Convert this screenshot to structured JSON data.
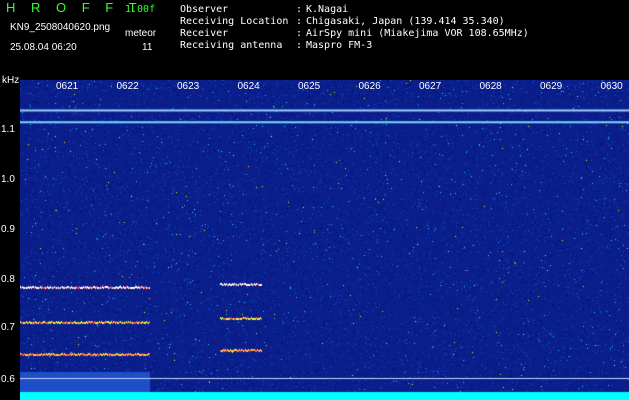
{
  "header": {
    "app_name": "H R O F F T",
    "version": "1.00f",
    "filename": "KN9_2508040620.png",
    "mode": "meteor",
    "datetime": "25.08.04 06:20",
    "count": "11",
    "meta": [
      {
        "key": "Observer",
        "value": "K.Nagai"
      },
      {
        "key": "Receiving Location",
        "value": "Chigasaki, Japan (139.414 35.340)"
      },
      {
        "key": "Receiver",
        "value": "AirSpy mini (Miakejima VOR 108.65MHz)"
      },
      {
        "key": "Receiving antenna",
        "value": "Maspro FM-3"
      }
    ]
  },
  "axis": {
    "ylabel": "kHz",
    "y_ticks": [
      "1.1",
      "1.0",
      "0.9",
      "0.8",
      "0.7",
      "0.6"
    ],
    "x_ticks": [
      "0621",
      "0622",
      "0623",
      "0624",
      "0625",
      "0626",
      "0627",
      "0628",
      "0629",
      "0630"
    ]
  },
  "colors": {
    "background": "#000000",
    "noise_base": "#0a1e8c",
    "trace": "#ffffff",
    "text": "#ffffff",
    "accent": "#33ff33",
    "baseline": "#00ffff"
  },
  "chart_data": {
    "type": "heatmap",
    "xlabel": "",
    "ylabel": "kHz",
    "ylim": [
      0.58,
      1.14
    ],
    "x": [
      "0621",
      "0622",
      "0623",
      "0624",
      "0625",
      "0626",
      "0627",
      "0628",
      "0629",
      "0630"
    ],
    "series": [
      {
        "values": [
          1.09
        ]
      },
      {
        "values": [
          1.07
        ]
      }
    ]
  }
}
